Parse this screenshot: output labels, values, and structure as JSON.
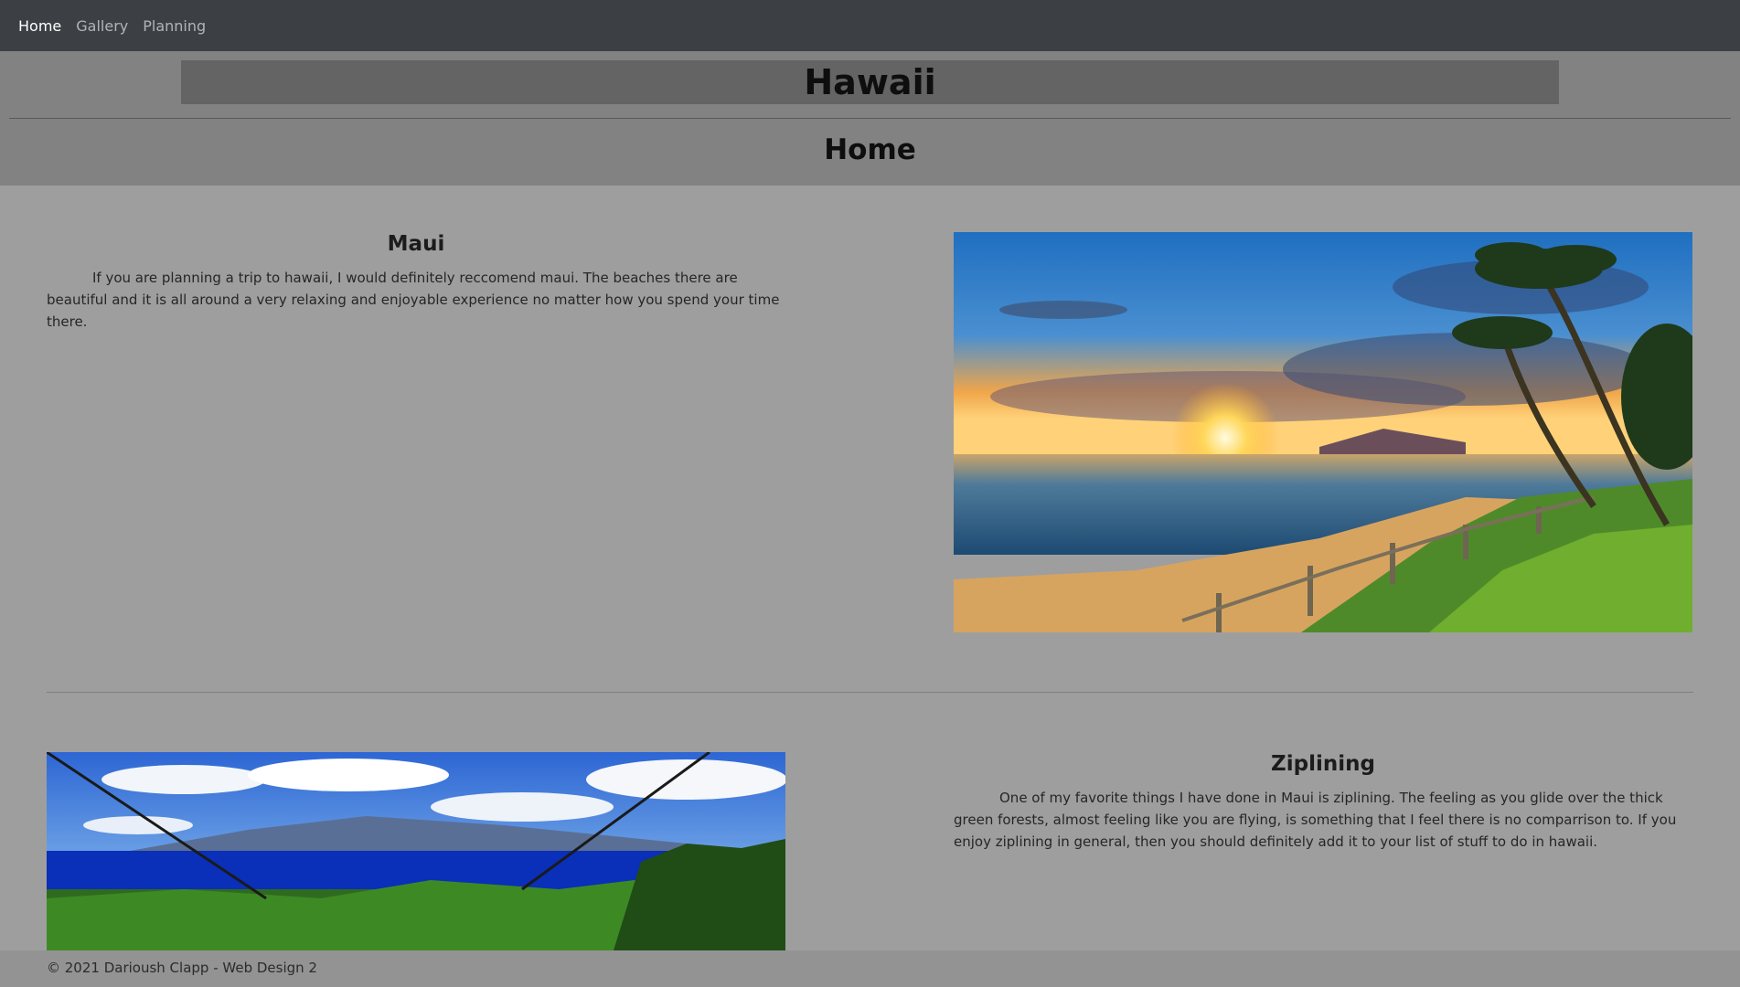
{
  "nav": {
    "items": [
      {
        "label": "Home"
      },
      {
        "label": "Gallery"
      },
      {
        "label": "Planning"
      }
    ]
  },
  "header": {
    "site_title": "Hawaii",
    "page_heading": "Home"
  },
  "sections": [
    {
      "title": "Maui",
      "text": "If you are planning a trip to hawaii, I would definitely reccomend maui. The beaches there are beautiful and it is all around a very relaxing and enjoyable experience no matter how you spend your time there."
    },
    {
      "title": "Ziplining",
      "text": "One of my favorite things I have done in Maui is ziplining. The feeling as you glide over the thick green forests, almost feeling like you are flying, is something that I feel there is no comparrison to. If you enjoy ziplining in general, then you should definitely add it to your list of stuff to do in hawaii."
    }
  ],
  "footer": {
    "text": "© 2021 Darioush Clapp - Web Design 2"
  },
  "colors": {
    "navbar": "#3c4044",
    "page_bg": "#9e9e9e",
    "header_bg": "#828282",
    "title_box": "#646464"
  }
}
